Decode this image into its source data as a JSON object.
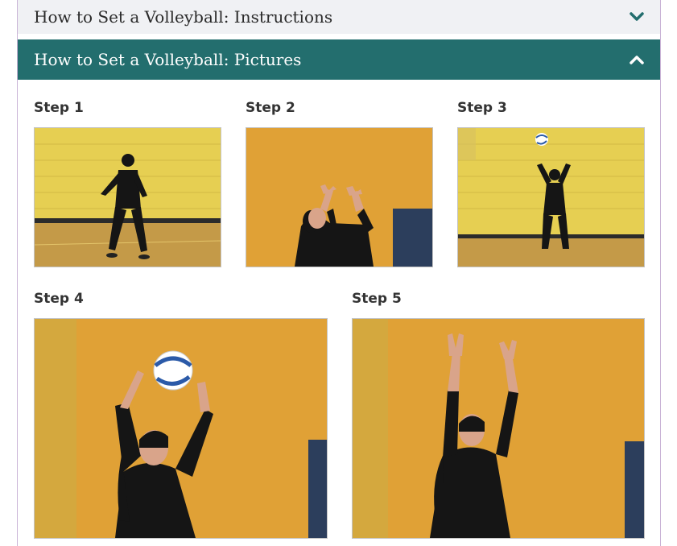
{
  "accordion": {
    "instructions": {
      "title": "How to Set a Volleyball: Instructions",
      "state": "collapsed",
      "icon": "chevron-down-icon"
    },
    "pictures": {
      "title": "How to Set a Volleyball: Pictures",
      "state": "expanded",
      "icon": "chevron-up-icon"
    }
  },
  "steps": [
    {
      "label": "Step 1",
      "image": "step-1-photo"
    },
    {
      "label": "Step 2",
      "image": "step-2-photo"
    },
    {
      "label": "Step 3",
      "image": "step-3-photo"
    },
    {
      "label": "Step 4",
      "image": "step-4-photo"
    },
    {
      "label": "Step 5",
      "image": "step-5-photo"
    }
  ],
  "colors": {
    "accent": "#236e6e",
    "collapsed_header_bg": "#f0f1f4",
    "chevron": "#236e6e",
    "wall_yellow": "#e6c84a",
    "wall_orange": "#e0a136",
    "jersey": "#151515"
  }
}
